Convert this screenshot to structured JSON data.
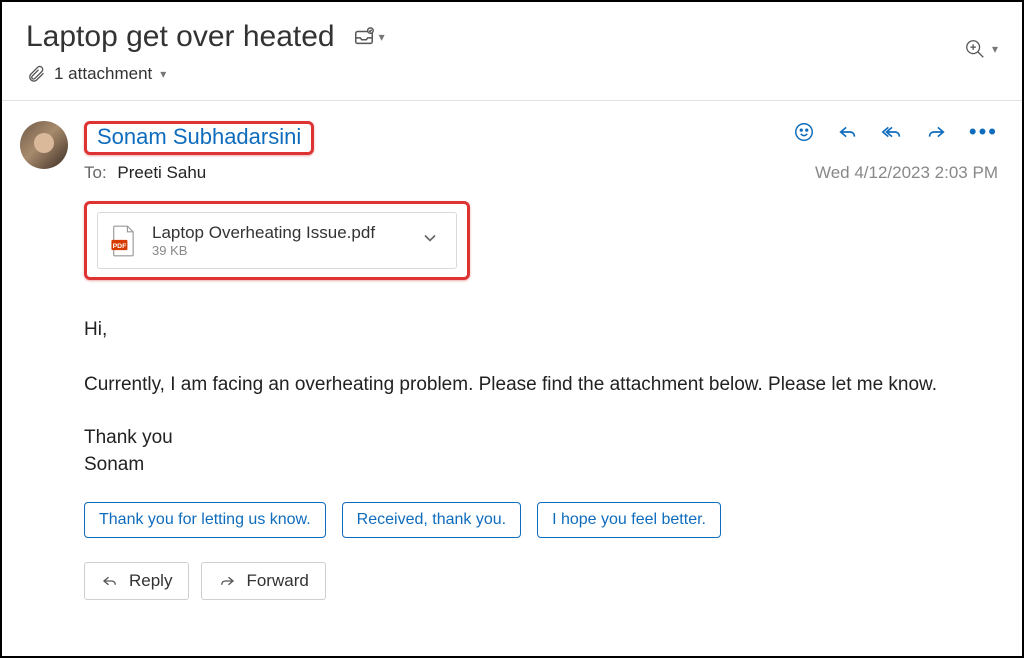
{
  "header": {
    "subject": "Laptop get over heated",
    "attachment_summary": "1 attachment"
  },
  "sender": {
    "name": "Sonam Subhadarsini"
  },
  "recipients": {
    "to_label": "To:",
    "to_name": "Preeti Sahu"
  },
  "timestamp": "Wed 4/12/2023 2:03 PM",
  "attachment": {
    "filename": "Laptop Overheating Issue.pdf",
    "size": "39 KB"
  },
  "body": {
    "greeting": "Hi,",
    "paragraph": "Currently, I am facing an overheating problem. Please find the attachment below. Please let me know.",
    "signoff_line1": "Thank you",
    "signoff_line2": "Sonam"
  },
  "quick_replies": [
    "Thank you for letting us know.",
    "Received, thank you.",
    "I hope you feel better."
  ],
  "buttons": {
    "reply": "Reply",
    "forward": "Forward"
  }
}
